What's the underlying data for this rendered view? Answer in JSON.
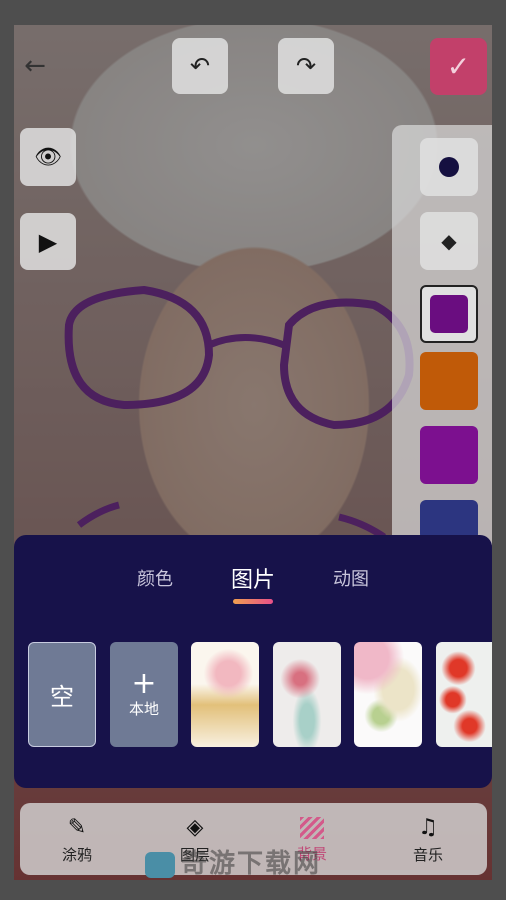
{
  "toolbar": {
    "back": "arrow-left-icon",
    "undo": "undo-icon",
    "redo": "redo-icon",
    "confirm": "check-icon"
  },
  "left_tools": [
    "eye-hidden-icon",
    "play-icon"
  ],
  "right_tools": {
    "brush": "brush-dot-icon",
    "eraser": "eraser-icon",
    "swatches": [
      "#6a0d80",
      "#c05a08",
      "#7c108f",
      "#2c3580"
    ],
    "selected": 0
  },
  "panel": {
    "tabs": [
      {
        "label": "颜色"
      },
      {
        "label": "图片"
      },
      {
        "label": "动图"
      }
    ],
    "active_tab": 1,
    "tiles": {
      "empty": "空",
      "local_plus": "+",
      "local": "本地"
    }
  },
  "nav": {
    "items": [
      {
        "label": "涂鸦"
      },
      {
        "label": "图层"
      },
      {
        "label": "背景"
      },
      {
        "label": "音乐"
      }
    ]
  },
  "watermark": "奇游下载网",
  "colors": {
    "accent": "#d8426e",
    "panel": "#17124a",
    "background_icon": "#d35a8a"
  }
}
